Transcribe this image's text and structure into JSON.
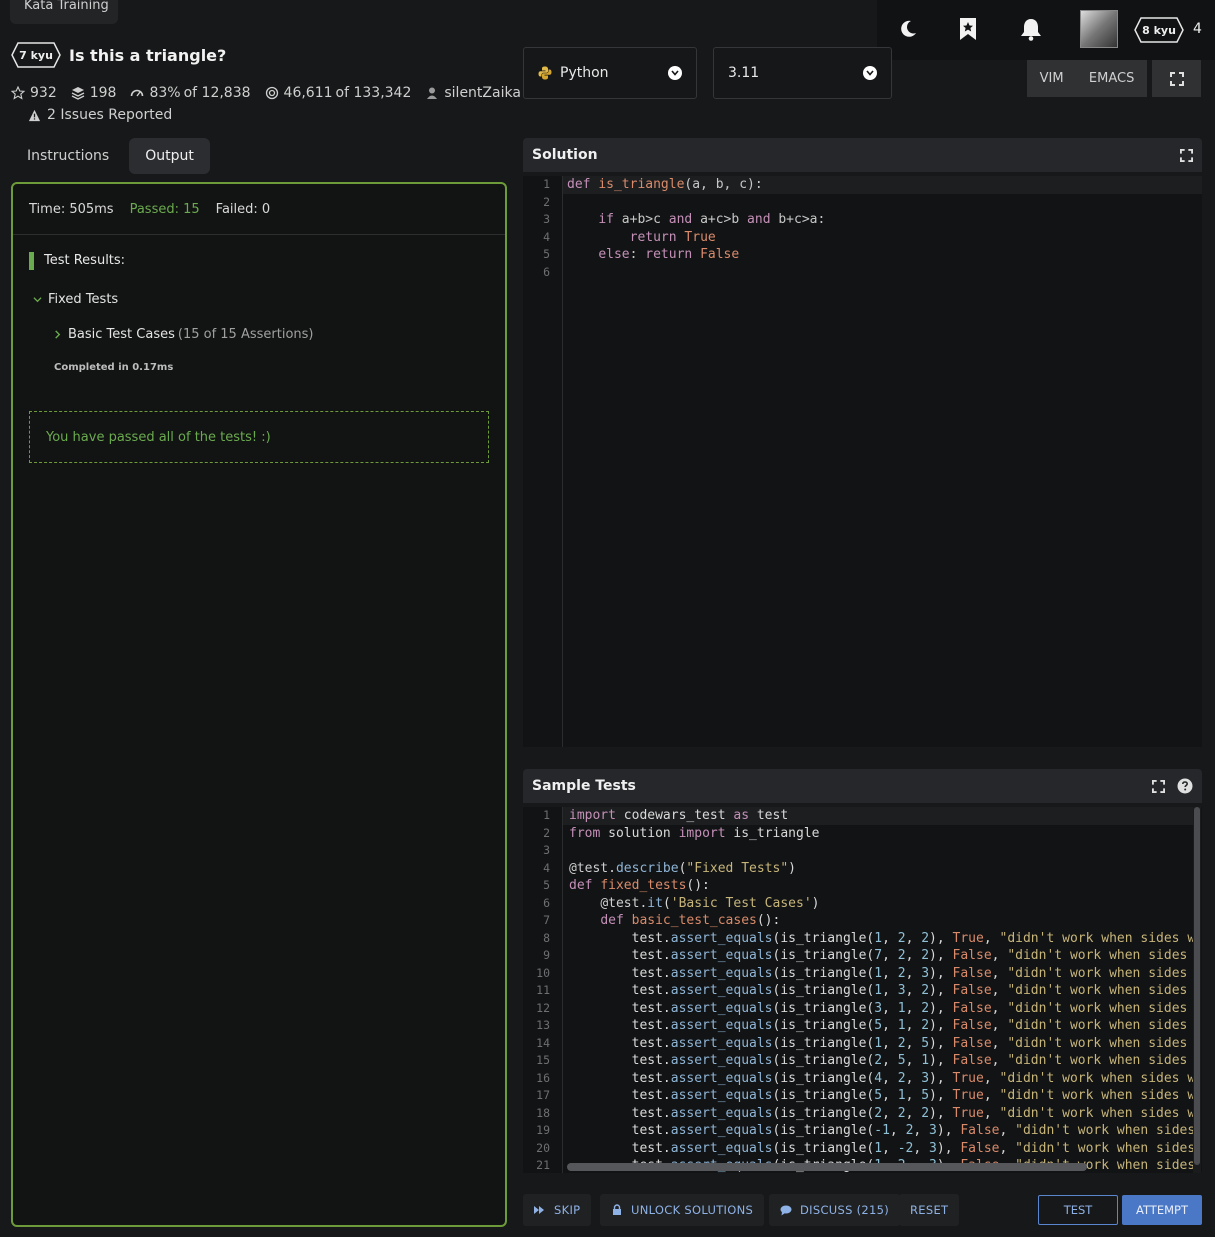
{
  "header": {
    "breadcrumb_tab": "Kata Training",
    "kata_rank": "7 kyu",
    "kata_title": "Is this a triangle?",
    "stats": {
      "stars": "932",
      "collections": "198",
      "satisfaction": "83%",
      "satisfaction_of": "of 12,838",
      "completed": "46,611",
      "completed_of": "of 133,342",
      "author": "silentZaika"
    },
    "issues": "2 Issues Reported",
    "user_rank": "8 kyu",
    "honor": "4"
  },
  "tabs": [
    {
      "label": "Instructions"
    },
    {
      "label": "Output"
    }
  ],
  "output": {
    "time": "Time: 505ms",
    "passed": "Passed: 15",
    "failed": "Failed: 0",
    "test_results": "Test Results:",
    "group": "Fixed Tests",
    "case_label": "Basic Test Cases",
    "case_sub": "(15 of 15 Assertions)",
    "completed_in": "Completed in 0.17ms",
    "pass_message": "You have passed all of the tests! :)"
  },
  "editor": {
    "language": "Python",
    "version": "3.11",
    "modes": [
      "VIM",
      "EMACS"
    ],
    "solution_title": "Solution",
    "sample_title": "Sample Tests"
  },
  "footer": {
    "skip": "SKIP",
    "unlock": "UNLOCK SOLUTIONS",
    "discuss": "DISCUSS (215)",
    "reset": "RESET",
    "test": "TEST",
    "attempt": "ATTEMPT"
  },
  "colors": {
    "accent_green": "#6bab4f",
    "accent_blue": "#4a78c6"
  },
  "icons": [
    "moon-icon",
    "bookmark-icon",
    "bell-icon",
    "python-icon",
    "fullscreen-icon",
    "help-icon"
  ]
}
